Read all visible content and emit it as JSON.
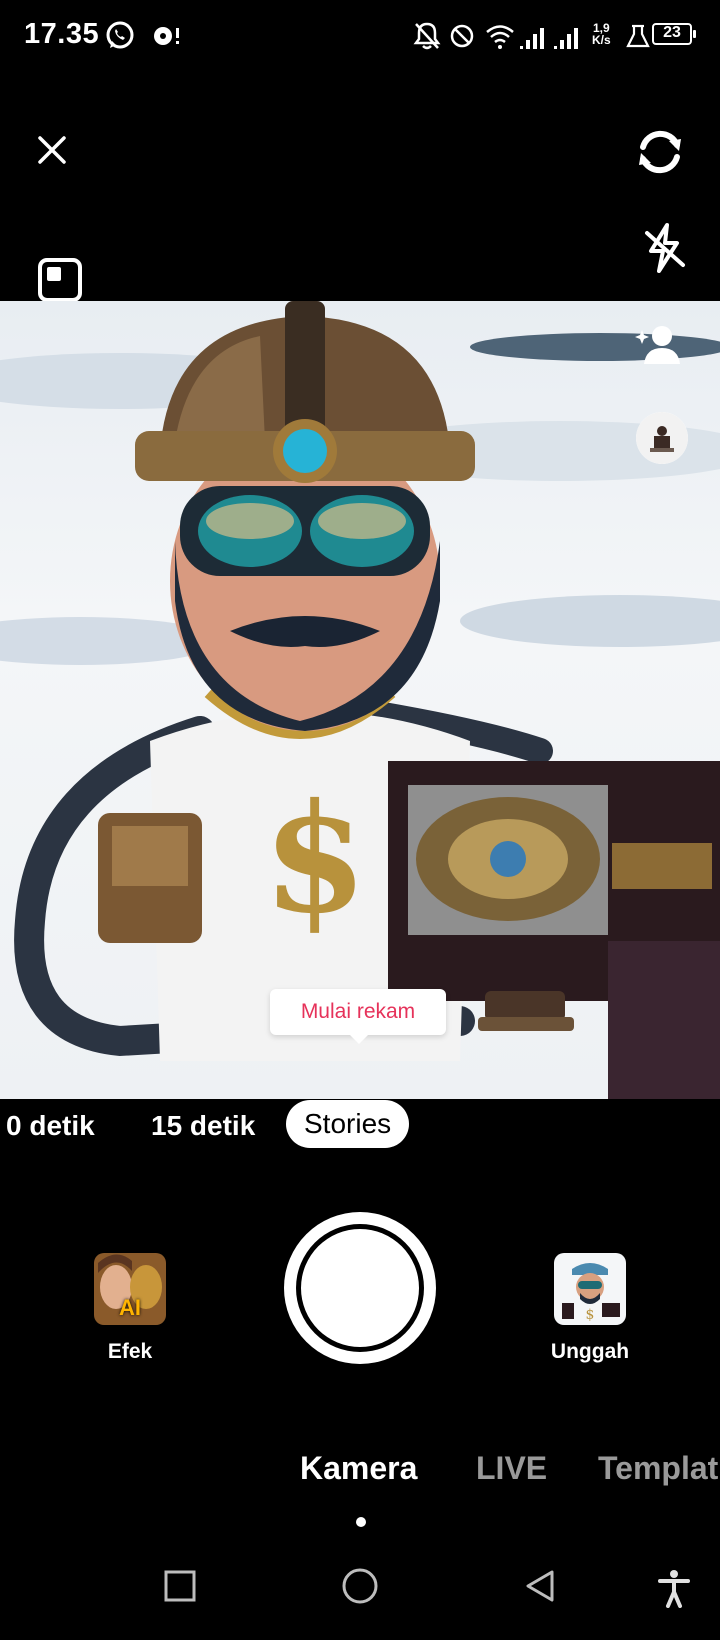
{
  "status": {
    "time": "17.35",
    "net_speed_value": "1,9",
    "net_speed_unit": "K/s",
    "battery": "23"
  },
  "top_controls": {
    "close_icon": "close-icon",
    "flip_icon": "flip-camera-icon",
    "flash_icon": "flash-off-icon",
    "ratio_icon": "aspect-ratio-icon"
  },
  "tooltip": {
    "text": "Mulai rekam"
  },
  "duration": {
    "options": [
      "0 detik",
      "15 detik",
      "Stories"
    ],
    "selected": "Stories"
  },
  "capture": {
    "effects_label": "Efek",
    "upload_label": "Unggah",
    "effects_badge": "AI"
  },
  "modes": {
    "items": [
      "Kamera",
      "LIVE",
      "Templat"
    ],
    "active": "Kamera"
  },
  "colors": {
    "accent": "#e6325a",
    "inactive_mode": "#9a9a9a"
  }
}
